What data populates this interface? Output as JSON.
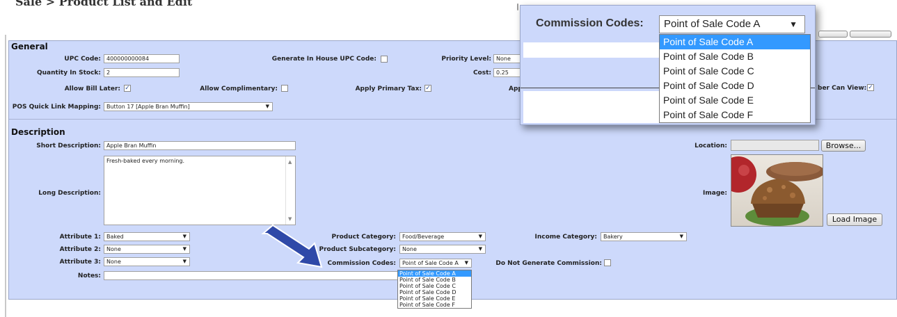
{
  "breadcrumb": "Sale > Product List and Edit",
  "general": {
    "title": "General",
    "upc_label": "UPC Code:",
    "upc_value": "400000000084",
    "generate_label": "Generate In House UPC Code:",
    "priority_label": "Priority Level:",
    "priority_value": "None",
    "qty_label": "Quantity In Stock:",
    "qty_value": "2",
    "cost_label": "Cost:",
    "cost_value": "0.25",
    "bill_later_label": "Allow Bill Later:",
    "complimentary_label": "Allow Complimentary:",
    "primary_tax_label": "Apply Primary Tax:",
    "partial_label": "App",
    "member_view_label": "ber Can View:",
    "pos_label": "POS Quick Link Mapping:",
    "pos_value": "Button 17 [Apple Bran Muffin]"
  },
  "description": {
    "title": "Description",
    "short_label": "Short Description:",
    "short_value": "Apple Bran Muffin",
    "long_label": "Long Description:",
    "long_value": "Fresh-baked every morning.",
    "location_label": "Location:",
    "browse_label": "Browse...",
    "image_label": "Image:",
    "load_image_label": "Load Image",
    "attr1_label": "Attribute 1:",
    "attr1_value": "Baked",
    "attr2_label": "Attribute 2:",
    "attr2_value": "None",
    "attr3_label": "Attribute 3:",
    "attr3_value": "None",
    "notes_label": "Notes:",
    "product_cat_label": "Product Category:",
    "product_cat_value": "Food/Beverage",
    "product_subcat_label": "Product Subcategory:",
    "product_subcat_value": "None",
    "income_cat_label": "Income Category:",
    "income_cat_value": "Bakery",
    "commission_label": "Commission Codes:",
    "commission_value": "Point of Sale Code A",
    "no_commission_label": "Do Not Generate Commission:"
  },
  "commission_options": [
    "Point of Sale Code A",
    "Point of Sale Code B",
    "Point of Sale Code C",
    "Point of Sale Code D",
    "Point of Sale Code E",
    "Point of Sale Code F"
  ],
  "checks": {
    "generate_upc": false,
    "bill_later": true,
    "complimentary": false,
    "primary_tax": true,
    "member_view": true,
    "no_commission": false
  },
  "colors": {
    "panel": "#cdd9fb",
    "selection": "#3399ff",
    "arrow": "#2f49a8"
  },
  "icons": {
    "arrow": "arrow-pointer-icon",
    "dropdown": "chevron-down-icon"
  }
}
